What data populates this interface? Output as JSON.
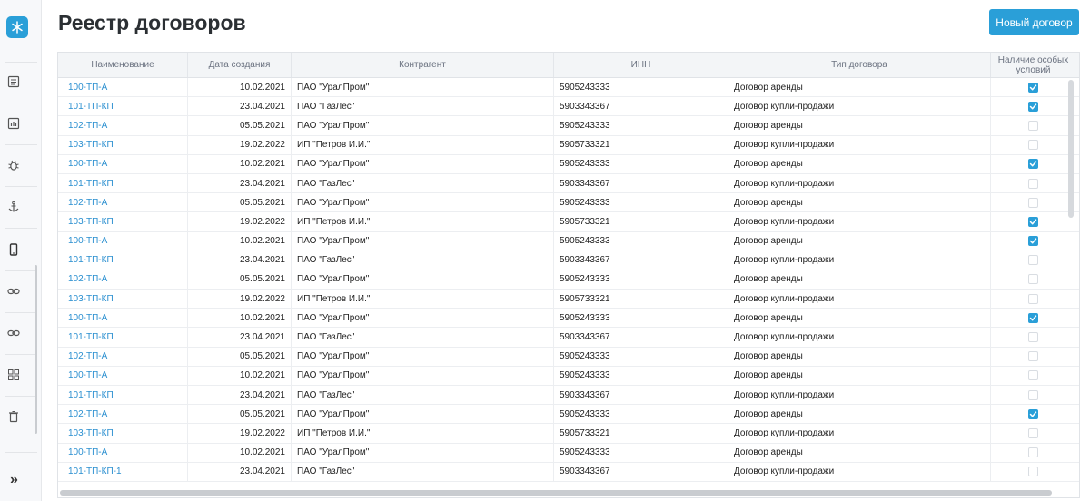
{
  "page": {
    "title": "Реестр договоров",
    "new_button": "Новый договор"
  },
  "sidebar": {
    "expand": "»"
  },
  "table": {
    "columns": [
      "Наименование",
      "Дата создания",
      "Контрагент",
      "ИНН",
      "Тип договора",
      "Наличие особых условий"
    ],
    "rows": [
      {
        "name": "100-ТП-А",
        "date": "10.02.2021",
        "contractor": "ПАО \"УралПром\"",
        "inn": "5905243333",
        "type": "Договор аренды",
        "special": true
      },
      {
        "name": "101-ТП-КП",
        "date": "23.04.2021",
        "contractor": "ПАО \"ГазЛес\"",
        "inn": "5903343367",
        "type": "Договор купли-продажи",
        "special": true
      },
      {
        "name": "102-ТП-А",
        "date": "05.05.2021",
        "contractor": "ПАО \"УралПром\"",
        "inn": "5905243333",
        "type": "Договор аренды",
        "special": false
      },
      {
        "name": "103-ТП-КП",
        "date": "19.02.2022",
        "contractor": "ИП \"Петров И.И.\"",
        "inn": "5905733321",
        "type": "Договор купли-продажи",
        "special": false
      },
      {
        "name": "100-ТП-А",
        "date": "10.02.2021",
        "contractor": "ПАО \"УралПром\"",
        "inn": "5905243333",
        "type": "Договор аренды",
        "special": true
      },
      {
        "name": "101-ТП-КП",
        "date": "23.04.2021",
        "contractor": "ПАО \"ГазЛес\"",
        "inn": "5903343367",
        "type": "Договор купли-продажи",
        "special": false
      },
      {
        "name": "102-ТП-А",
        "date": "05.05.2021",
        "contractor": "ПАО \"УралПром\"",
        "inn": "5905243333",
        "type": "Договор аренды",
        "special": false
      },
      {
        "name": "103-ТП-КП",
        "date": "19.02.2022",
        "contractor": "ИП \"Петров И.И.\"",
        "inn": "5905733321",
        "type": "Договор купли-продажи",
        "special": true
      },
      {
        "name": "100-ТП-А",
        "date": "10.02.2021",
        "contractor": "ПАО \"УралПром\"",
        "inn": "5905243333",
        "type": "Договор аренды",
        "special": true
      },
      {
        "name": "101-ТП-КП",
        "date": "23.04.2021",
        "contractor": "ПАО \"ГазЛес\"",
        "inn": "5903343367",
        "type": "Договор купли-продажи",
        "special": false
      },
      {
        "name": "102-ТП-А",
        "date": "05.05.2021",
        "contractor": "ПАО \"УралПром\"",
        "inn": "5905243333",
        "type": "Договор аренды",
        "special": false
      },
      {
        "name": "103-ТП-КП",
        "date": "19.02.2022",
        "contractor": "ИП \"Петров И.И.\"",
        "inn": "5905733321",
        "type": "Договор купли-продажи",
        "special": false
      },
      {
        "name": "100-ТП-А",
        "date": "10.02.2021",
        "contractor": "ПАО \"УралПром\"",
        "inn": "5905243333",
        "type": "Договор аренды",
        "special": true
      },
      {
        "name": "101-ТП-КП",
        "date": "23.04.2021",
        "contractor": "ПАО \"ГазЛес\"",
        "inn": "5903343367",
        "type": "Договор купли-продажи",
        "special": false
      },
      {
        "name": "102-ТП-А",
        "date": "05.05.2021",
        "contractor": "ПАО \"УралПром\"",
        "inn": "5905243333",
        "type": "Договор аренды",
        "special": false
      },
      {
        "name": "100-ТП-А",
        "date": "10.02.2021",
        "contractor": "ПАО \"УралПром\"",
        "inn": "5905243333",
        "type": "Договор аренды",
        "special": false
      },
      {
        "name": "101-ТП-КП",
        "date": "23.04.2021",
        "contractor": "ПАО \"ГазЛес\"",
        "inn": "5903343367",
        "type": "Договор купли-продажи",
        "special": false
      },
      {
        "name": "102-ТП-А",
        "date": "05.05.2021",
        "contractor": "ПАО \"УралПром\"",
        "inn": "5905243333",
        "type": "Договор аренды",
        "special": true
      },
      {
        "name": "103-ТП-КП",
        "date": "19.02.2022",
        "contractor": "ИП \"Петров И.И.\"",
        "inn": "5905733321",
        "type": "Договор купли-продажи",
        "special": false
      },
      {
        "name": "100-ТП-А",
        "date": "10.02.2021",
        "contractor": "ПАО \"УралПром\"",
        "inn": "5905243333",
        "type": "Договор аренды",
        "special": false
      },
      {
        "name": "101-ТП-КП-1",
        "date": "23.04.2021",
        "contractor": "ПАО \"ГазЛес\"",
        "inn": "5903343367",
        "type": "Договор купли-продажи",
        "special": false
      }
    ]
  }
}
